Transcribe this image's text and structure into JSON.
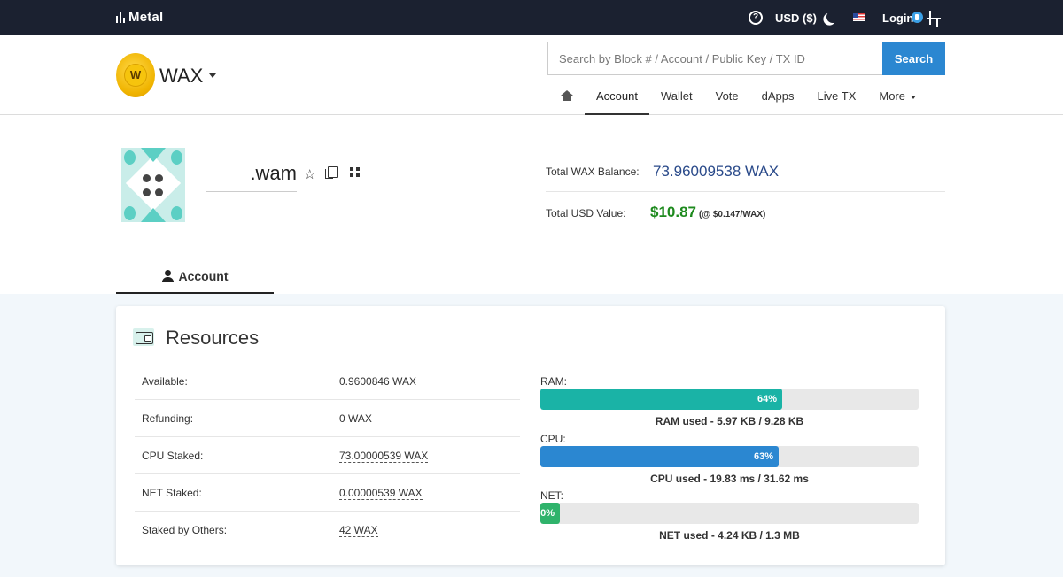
{
  "topbar": {
    "brand": "Metal",
    "currency": "USD ($)",
    "login": "Login"
  },
  "header": {
    "chain_logo_letter": "W",
    "chain_name": "WAX",
    "search": {
      "placeholder": "Search by Block # / Account / Public Key / TX ID",
      "button": "Search"
    },
    "nav": [
      {
        "label": "Account"
      },
      {
        "label": "Wallet"
      },
      {
        "label": "Vote"
      },
      {
        "label": "dApps"
      },
      {
        "label": "Live TX"
      },
      {
        "label": "More"
      }
    ]
  },
  "profile": {
    "account_name": ".wam",
    "balance_label": "Total WAX Balance:",
    "balance_value": "73.96009538 WAX",
    "usd_label": "Total USD Value:",
    "usd_value": "$10.87",
    "usd_rate": "(@ $0.147/WAX)",
    "tab_account": "Account"
  },
  "resources": {
    "title": "Resources",
    "rows": [
      {
        "label": "Available:",
        "value": "0.9600846 WAX"
      },
      {
        "label": "Refunding:",
        "value": "0 WAX"
      },
      {
        "label": "CPU Staked:",
        "value": "73.00000539 WAX"
      },
      {
        "label": "NET Staked:",
        "value": "0.00000539 WAX"
      },
      {
        "label": "Staked by Others:",
        "value": "42 WAX"
      }
    ],
    "meters": [
      {
        "label": "RAM:",
        "percent_text": "64%",
        "fraction": 0.64,
        "used": "RAM used - 5.97 KB / 9.28 KB",
        "color": "#1ab3a6"
      },
      {
        "label": "CPU:",
        "percent_text": "63%",
        "fraction": 0.63,
        "used": "CPU used - 19.83 ms / 31.62 ms",
        "color": "#2b87d1"
      },
      {
        "label": "NET:",
        "percent_text": "0%",
        "fraction": 0.0,
        "used": "NET used - 4.24 KB / 1.3 MB",
        "color": "#2fb36b"
      }
    ]
  },
  "colors": {
    "topbar_bg": "#1b2130",
    "accent_blue": "#2b87d1",
    "balance_blue": "#2a4a8a",
    "usd_green": "#1e8a1e",
    "avatar_teal": "#5ccfc4"
  }
}
